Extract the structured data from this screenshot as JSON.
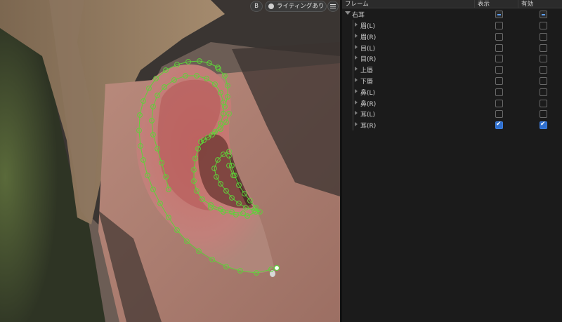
{
  "toolbar": {
    "b_label": "B",
    "lighting_label": "ライティングあり",
    "menu_icon": "hamburger-menu-icon"
  },
  "panel": {
    "headers": {
      "frame": "フレーム",
      "show": "表示",
      "enable": "有効"
    },
    "root": {
      "label": "右耳",
      "show": "mixed",
      "enable": "mixed"
    },
    "items": [
      {
        "label": "眉(L)",
        "show": false,
        "enable": false
      },
      {
        "label": "眉(R)",
        "show": false,
        "enable": false
      },
      {
        "label": "目(L)",
        "show": false,
        "enable": false
      },
      {
        "label": "目(R)",
        "show": false,
        "enable": false
      },
      {
        "label": "上唇",
        "show": false,
        "enable": false
      },
      {
        "label": "下唇",
        "show": false,
        "enable": false
      },
      {
        "label": "鼻(L)",
        "show": false,
        "enable": false
      },
      {
        "label": "鼻(R)",
        "show": false,
        "enable": false
      },
      {
        "label": "耳(L)",
        "show": false,
        "enable": false
      },
      {
        "label": "耳(R)",
        "show": true,
        "enable": true
      }
    ]
  },
  "colors": {
    "landmark": "#5fd13a",
    "checkbox_checked": "#2f6fce",
    "panel_bg": "#1b1b1b"
  }
}
